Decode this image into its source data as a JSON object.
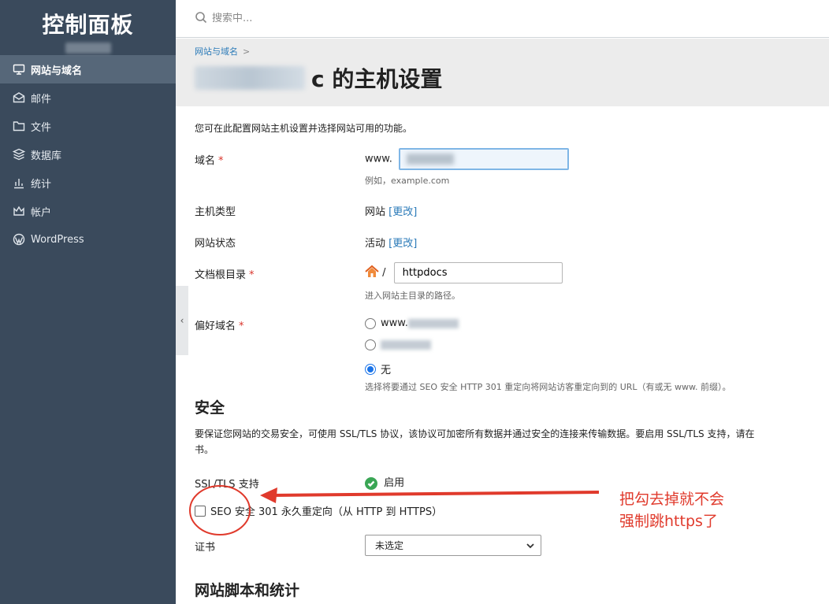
{
  "sidebar": {
    "brand": "控制面板",
    "items": [
      {
        "label": "网站与域名",
        "icon": "monitor-icon",
        "active": true
      },
      {
        "label": "邮件",
        "icon": "mail-icon"
      },
      {
        "label": "文件",
        "icon": "folder-icon"
      },
      {
        "label": "数据库",
        "icon": "database-icon"
      },
      {
        "label": "统计",
        "icon": "chart-icon"
      },
      {
        "label": "帐户",
        "icon": "crown-icon"
      },
      {
        "label": "WordPress",
        "icon": "wordpress-icon"
      }
    ]
  },
  "search": {
    "placeholder": "搜索中..."
  },
  "header": {
    "breadcrumb": "网站与域名",
    "title_suffix": "c 的主机设置"
  },
  "form": {
    "intro": "您可在此配置网站主机设置并选择网站可用的功能。",
    "domain_label": "域名",
    "domain_prefix": "www.",
    "domain_hint": "例如，example.com",
    "hosting_type_label": "主机类型",
    "hosting_type_value": "网站",
    "change_link": "[更改]",
    "site_status_label": "网站状态",
    "site_status_value": "活动",
    "docroot_label": "文档根目录",
    "docroot_slash": "/",
    "docroot_value": "httpdocs",
    "docroot_hint": "进入网站主目录的路径。",
    "preferred_domain_label": "偏好域名",
    "preferred_opt1": "www.",
    "preferred_opt3": "无",
    "preferred_hint": "选择将要通过 SEO 安全 HTTP 301 重定向将网站访客重定向到的 URL（有或无 www. 前缀）。"
  },
  "security": {
    "title": "安全",
    "desc": "要保证您网站的交易安全，可使用 SSL/TLS 协议，该协议可加密所有数据并通过安全的连接来传输数据。要启用 SSL/TLS 支持，请在",
    "desc_line2": "书。",
    "ssl_label": "SSL/TLS 支持",
    "ssl_value": "启用",
    "seo_redirect_label": "SEO 安全 301 永久重定向（从 HTTP 到 HTTPS）",
    "cert_label": "证书",
    "cert_value": "未选定"
  },
  "scripts_section": {
    "title": "网站脚本和统计"
  },
  "annotation": {
    "line1": "把勾去掉就不会",
    "line2": "强制跳https了",
    "color": "#e03a2c"
  }
}
